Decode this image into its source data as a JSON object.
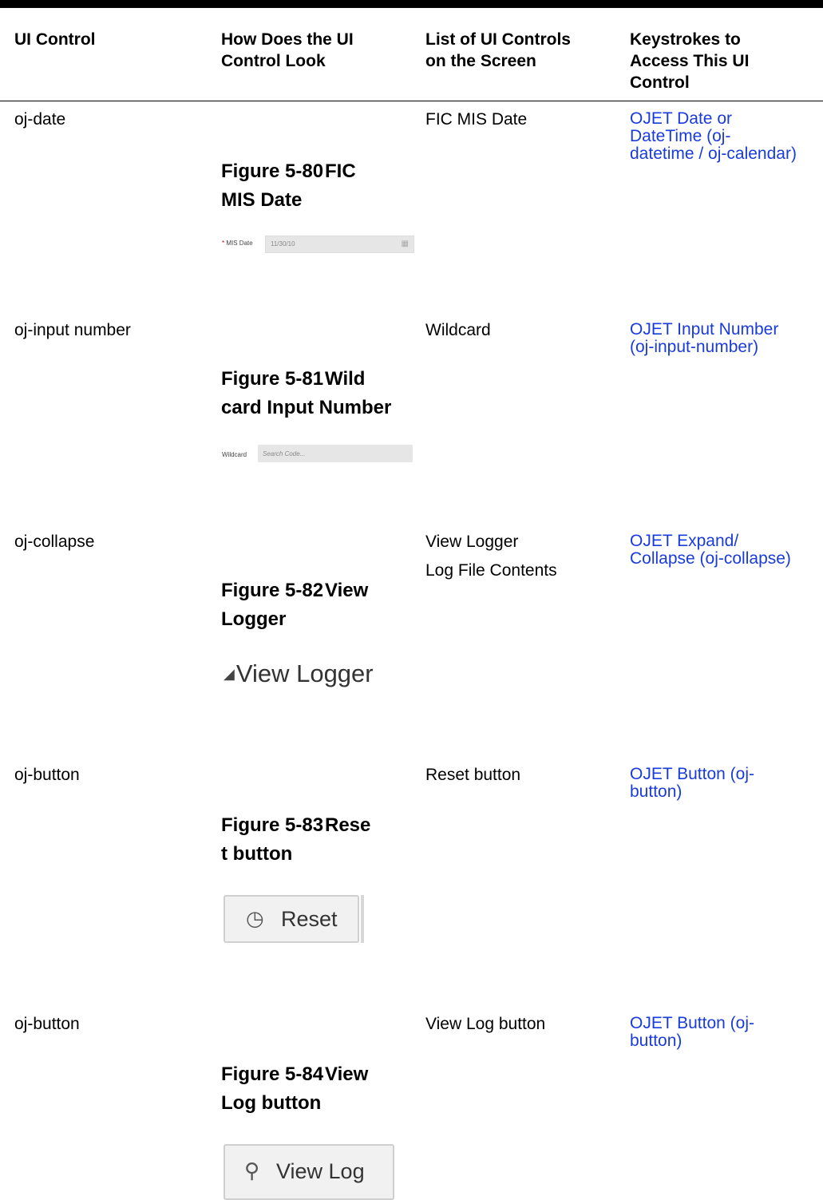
{
  "headers": [
    "UI Control",
    "How Does the UI Control Look",
    "List of UI Controls on the Screen",
    "Keystrokes to Access This UI Control"
  ],
  "header_lines": {
    "h1": [
      "UI Control"
    ],
    "h2": [
      "How Does the UI",
      "Control Look"
    ],
    "h3": [
      "List of UI Controls",
      "on the Screen"
    ],
    "h4": [
      "Keystrokes to",
      "Access This UI",
      "Control"
    ]
  },
  "rows": [
    {
      "control": "oj-date",
      "figure_num": "Figure 5-80",
      "figure_title_lines": [
        "FIC",
        "MIS Date"
      ],
      "screen_controls": [
        "FIC MIS Date"
      ],
      "link_lines": [
        "OJET Date or",
        "DateTime (oj-",
        "datetime / oj-calendar)"
      ]
    },
    {
      "control": "oj-input number",
      "figure_num": "Figure 5-81",
      "figure_title_lines": [
        "Wild",
        "card Input Number"
      ],
      "screen_controls": [
        "Wildcard"
      ],
      "link_lines": [
        "OJET Input Number",
        "(oj-input-number)"
      ]
    },
    {
      "control": "oj-collapse",
      "figure_num": "Figure 5-82",
      "figure_title_lines": [
        "View",
        "Logger"
      ],
      "screen_controls": [
        "View Logger",
        "Log File Contents"
      ],
      "link_lines": [
        "OJET Expand/",
        "Collapse (oj-collapse)"
      ]
    },
    {
      "control": "oj-button",
      "figure_num": "Figure 5-83",
      "figure_title_lines": [
        "Rese",
        "t button"
      ],
      "screen_controls": [
        "Reset button"
      ],
      "link_lines": [
        "OJET Button (oj-",
        "button)"
      ]
    },
    {
      "control": "oj-button",
      "figure_num": "Figure 5-84",
      "figure_title_lines": [
        "View",
        "Log button"
      ],
      "screen_controls": [
        "View Log button"
      ],
      "link_lines": [
        "OJET Button (oj-",
        "button)"
      ]
    }
  ],
  "figures": {
    "mis_date": {
      "label": "MIS Date",
      "required_marker": "*",
      "value": "11/30/10",
      "icon": "calendar-icon"
    },
    "wildcard": {
      "label": "Wildcard",
      "placeholder": "Search Code..."
    },
    "view_logger": {
      "label": "View Logger",
      "icon": "collapse-triangle-icon"
    },
    "reset": {
      "label": "Reset",
      "icon": "clock-icon"
    },
    "view_log": {
      "label": "View Log",
      "icon": "search-icon"
    }
  },
  "colors": {
    "link": "#1a3bdc",
    "rule": "#000000"
  }
}
